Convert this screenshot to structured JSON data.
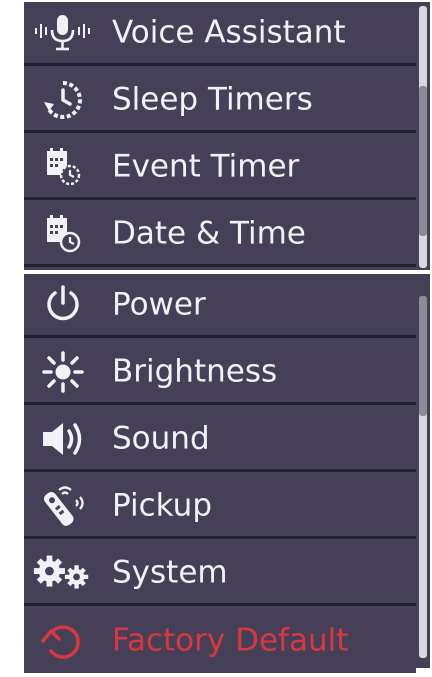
{
  "menu_top": {
    "items": [
      {
        "label": "Voice Assistant",
        "icon": "microphone-icon"
      },
      {
        "label": "Sleep Timers",
        "icon": "sleep-timer-icon"
      },
      {
        "label": "Event Timer",
        "icon": "event-timer-icon"
      },
      {
        "label": "Date & Time",
        "icon": "date-time-icon"
      }
    ],
    "scroll_position": 0.05
  },
  "menu_bottom": {
    "items": [
      {
        "label": "Power",
        "icon": "power-icon"
      },
      {
        "label": "Brightness",
        "icon": "brightness-icon"
      },
      {
        "label": "Sound",
        "icon": "speaker-icon"
      },
      {
        "label": "Pickup",
        "icon": "remote-pickup-icon"
      },
      {
        "label": "System",
        "icon": "gears-icon"
      },
      {
        "label": "Factory Default",
        "icon": "reset-icon"
      }
    ],
    "scroll_position": 0.0
  },
  "colors": {
    "panel": "#454058",
    "divider": "#222130",
    "text": "#f1f1f6",
    "warning": "#d9363e",
    "scroll_track": "#d9d7e0"
  }
}
